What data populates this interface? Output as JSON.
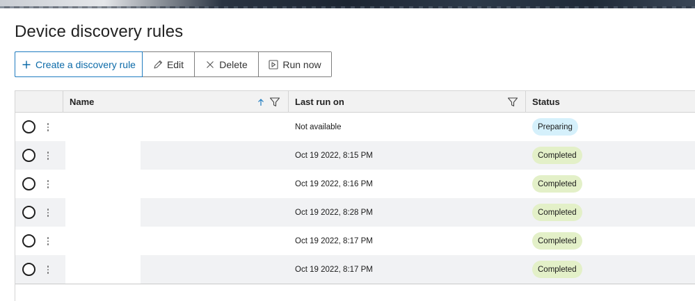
{
  "page": {
    "title": "Device discovery rules"
  },
  "toolbar": {
    "create_label": "Create a discovery rule",
    "edit_label": "Edit",
    "delete_label": "Delete",
    "run_label": "Run now"
  },
  "icons": {
    "create": "plus-icon",
    "edit": "pencil-icon",
    "delete": "x-icon",
    "run": "play-square-icon",
    "sort": "arrow-up-icon",
    "filter": "funnel-icon",
    "row_menu": "kebab-icon"
  },
  "colors": {
    "accent": "#0b6aa8",
    "preparing_bg": "#d5f0fb",
    "completed_bg": "#e3f0c8",
    "alt_row_bg": "#f1f2f4"
  },
  "table": {
    "columns": {
      "name": "Name",
      "last_run": "Last run on",
      "status": "Status"
    },
    "rows": [
      {
        "name": "",
        "last_run": "Not available",
        "status": "Preparing"
      },
      {
        "name": "",
        "last_run": "Oct 19 2022, 8:15 PM",
        "status": "Completed"
      },
      {
        "name": "",
        "last_run": "Oct 19 2022, 8:16 PM",
        "status": "Completed"
      },
      {
        "name": "",
        "last_run": "Oct 19 2022, 8:28 PM",
        "status": "Completed"
      },
      {
        "name": "",
        "last_run": "Oct 19 2022, 8:17 PM",
        "status": "Completed"
      },
      {
        "name": "",
        "last_run": "Oct 19 2022, 8:17 PM",
        "status": "Completed"
      }
    ]
  }
}
